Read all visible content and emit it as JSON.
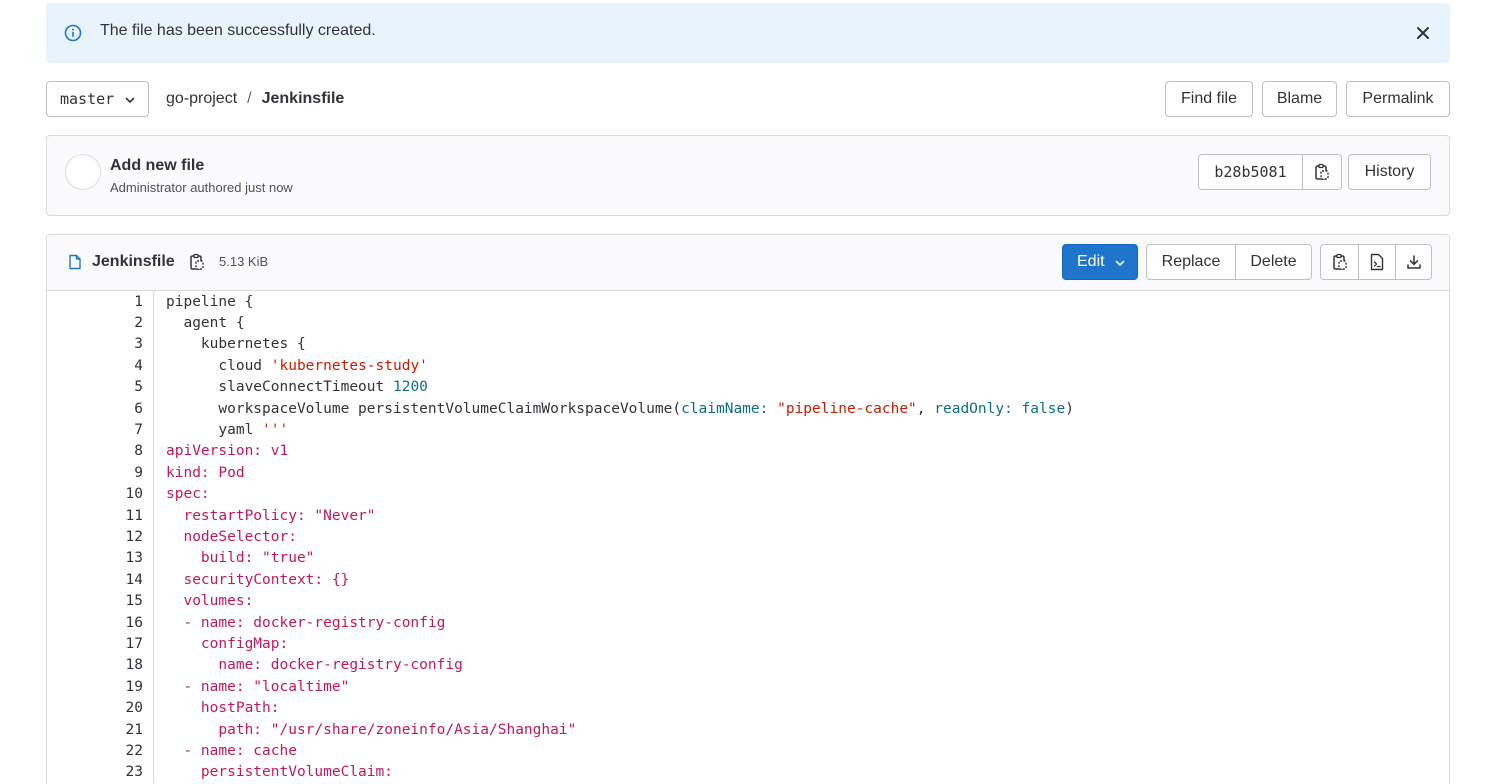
{
  "alert": {
    "message": "The file has been successfully created."
  },
  "branch": {
    "name": "master"
  },
  "breadcrumb": {
    "project": "go-project",
    "separator": "/",
    "file": "Jenkinsfile"
  },
  "toolbar": {
    "find_file": "Find file",
    "blame": "Blame",
    "permalink": "Permalink"
  },
  "commit": {
    "title": "Add new file",
    "author": "Administrator authored just now",
    "sha": "b28b5081",
    "history": "History"
  },
  "file": {
    "name": "Jenkinsfile",
    "size": "5.13 KiB",
    "edit": "Edit",
    "replace": "Replace",
    "delete": "Delete"
  },
  "code_lines": [
    {
      "n": "1",
      "segs": [
        [
          "",
          "pipeline {"
        ]
      ]
    },
    {
      "n": "2",
      "segs": [
        [
          "",
          "  agent {"
        ]
      ]
    },
    {
      "n": "3",
      "segs": [
        [
          "",
          "    kubernetes {"
        ]
      ]
    },
    {
      "n": "4",
      "segs": [
        [
          "",
          "      cloud "
        ],
        [
          "s",
          "'kubernetes-study'"
        ]
      ]
    },
    {
      "n": "5",
      "segs": [
        [
          "",
          "      slaveConnectTimeout "
        ],
        [
          "n",
          "1200"
        ]
      ]
    },
    {
      "n": "6",
      "segs": [
        [
          "",
          "      workspaceVolume persistentVolumeClaimWorkspaceVolume("
        ],
        [
          "k",
          "claimName:"
        ],
        [
          "",
          " "
        ],
        [
          "s",
          "\"pipeline-cache\""
        ],
        [
          "",
          ", "
        ],
        [
          "k",
          "readOnly:"
        ],
        [
          "",
          " "
        ],
        [
          "k",
          "false"
        ],
        [
          "",
          ")"
        ]
      ]
    },
    {
      "n": "7",
      "segs": [
        [
          "",
          "      yaml "
        ],
        [
          "s",
          "'''"
        ]
      ]
    },
    {
      "n": "8",
      "segs": [
        [
          "y",
          "apiVersion: v1"
        ]
      ]
    },
    {
      "n": "9",
      "segs": [
        [
          "y",
          "kind: Pod"
        ]
      ]
    },
    {
      "n": "10",
      "segs": [
        [
          "y",
          "spec:"
        ]
      ]
    },
    {
      "n": "11",
      "segs": [
        [
          "y",
          "  restartPolicy: \"Never\""
        ]
      ]
    },
    {
      "n": "12",
      "segs": [
        [
          "y",
          "  nodeSelector:"
        ]
      ]
    },
    {
      "n": "13",
      "segs": [
        [
          "y",
          "    build: \"true\""
        ]
      ]
    },
    {
      "n": "14",
      "segs": [
        [
          "y",
          "  securityContext: {}"
        ]
      ]
    },
    {
      "n": "15",
      "segs": [
        [
          "y",
          "  volumes:"
        ]
      ]
    },
    {
      "n": "16",
      "segs": [
        [
          "y",
          "  - name: docker-registry-config"
        ]
      ]
    },
    {
      "n": "17",
      "segs": [
        [
          "y",
          "    configMap:"
        ]
      ]
    },
    {
      "n": "18",
      "segs": [
        [
          "y",
          "      name: docker-registry-config"
        ]
      ]
    },
    {
      "n": "19",
      "segs": [
        [
          "y",
          "  - name: \"localtime\""
        ]
      ]
    },
    {
      "n": "20",
      "segs": [
        [
          "y",
          "    hostPath:"
        ]
      ]
    },
    {
      "n": "21",
      "segs": [
        [
          "y",
          "      path: \"/usr/share/zoneinfo/Asia/Shanghai\""
        ]
      ]
    },
    {
      "n": "22",
      "segs": [
        [
          "y",
          "  - name: cache"
        ]
      ]
    },
    {
      "n": "23",
      "segs": [
        [
          "y",
          "    persistentVolumeClaim:"
        ]
      ]
    }
  ]
}
